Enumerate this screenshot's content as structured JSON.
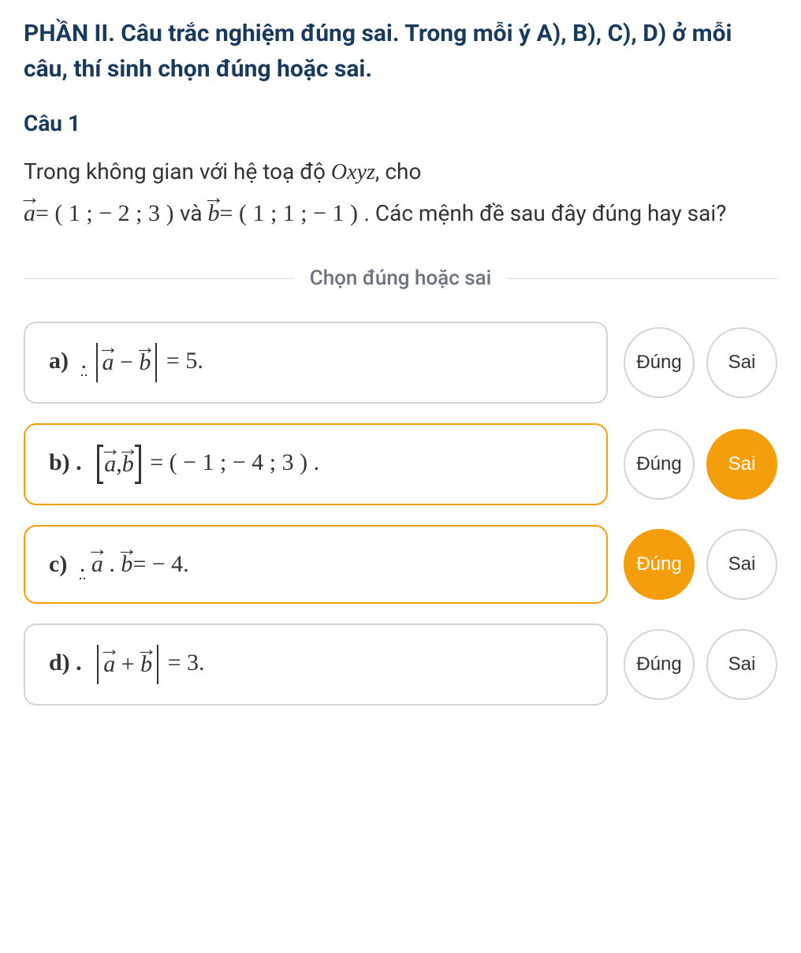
{
  "section": {
    "title": "PHẦN II. Câu trắc nghiệm đúng sai. Trong mỗi ý A), B), C), D) ở mỗi câu, thí sinh chọn đúng hoặc sai."
  },
  "question": {
    "number": "Câu 1",
    "text_part1": "Trong không gian với hệ toạ độ ",
    "coord_system": "Oxyz",
    "text_part2": ", cho",
    "vector_a": "a",
    "vector_a_value": "= ( 1 ; − 2 ; 3 )",
    "conjunction": " và ",
    "vector_b": "b",
    "vector_b_value": "= ( 1 ; 1 ; − 1 )",
    "text_part3": ". Các mệnh đề sau đây đúng hay sai?"
  },
  "divider": {
    "text": "Chọn đúng hoặc sai"
  },
  "options": {
    "a": {
      "label": "a) ",
      "expr_minus": "−",
      "expr_eq": " = 5.",
      "selected": false,
      "answer": null
    },
    "b": {
      "label": "b) . ",
      "expr_comma": ",",
      "expr_eq": " = ( − 1 ; − 4 ; 3 ) .",
      "selected": true,
      "answer": "sai"
    },
    "c": {
      "label": "c) ",
      "expr_dot": ".",
      "expr_eq": "= − 4.",
      "selected": true,
      "answer": "dung"
    },
    "d": {
      "label": "d) . ",
      "expr_plus": "+",
      "expr_eq": " = 3.",
      "selected": false,
      "answer": null
    }
  },
  "buttons": {
    "true": "Đúng",
    "false": "Sai"
  }
}
